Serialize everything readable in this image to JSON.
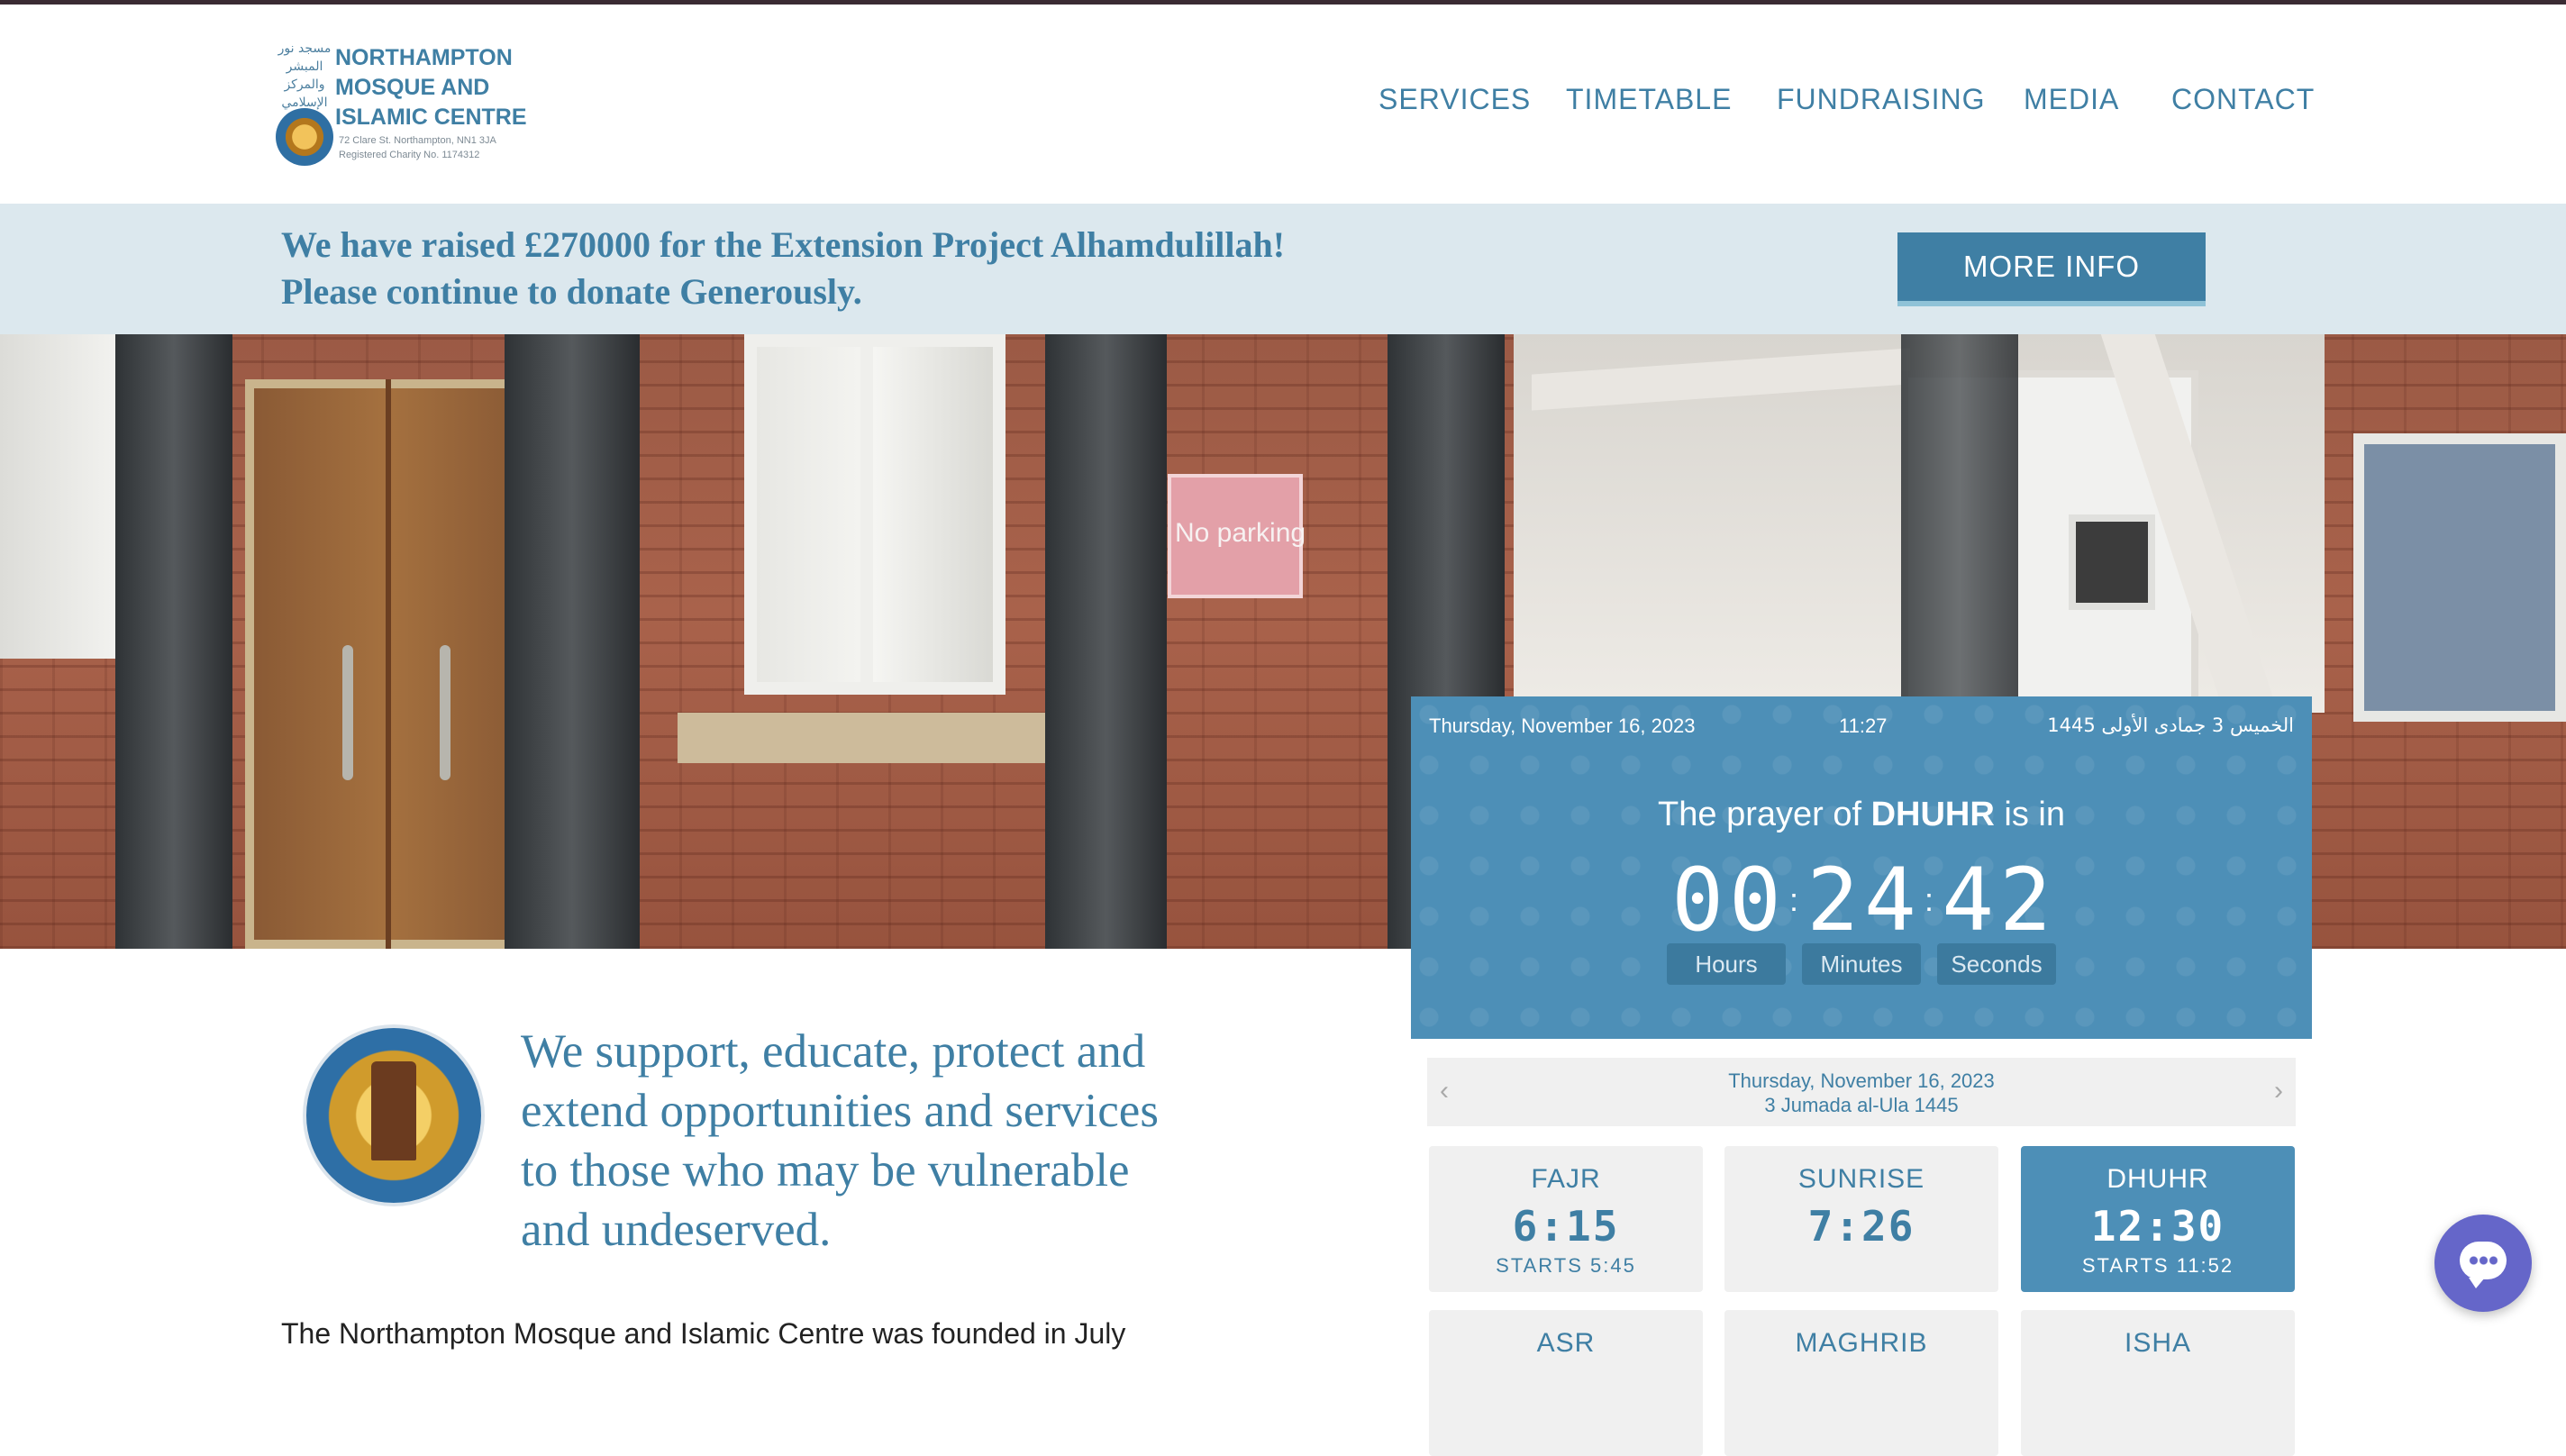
{
  "header": {
    "logo_title": "NORTHAMPTON MOSQUE AND ISLAMIC CENTRE",
    "logo_arabic": "مسجد نور المبشر والمركز الإسلامي",
    "logo_address": "72 Clare St. Northampton, NN1 3JA",
    "logo_charity": "Registered Charity No. 1174312",
    "nav": [
      "SERVICES",
      "TIMETABLE",
      "FUNDRAISING",
      "MEDIA",
      "CONTACT"
    ]
  },
  "banner": {
    "line1": "We have raised £270000 for the Extension Project Alhamdulillah!",
    "line2": "Please continue to donate Generously.",
    "button": "MORE INFO"
  },
  "hero": {
    "sign_text": "No parking"
  },
  "prayer_widget": {
    "date": "Thursday, November 16, 2023",
    "time": "11:27",
    "hijri_arabic": "الخميس 3 جمادى الأولى 1445",
    "prefix": "The prayer of",
    "prayer": "DHUHR",
    "suffix": "is in",
    "hours": "00",
    "minutes": "24",
    "seconds": "42",
    "hours_label": "Hours",
    "minutes_label": "Minutes",
    "seconds_label": "Seconds"
  },
  "timetable": {
    "date": "Thursday, November 16, 2023",
    "hijri": "3 Jumada al-Ula 1445",
    "prayers": [
      {
        "name": "FAJR",
        "time": "6:15",
        "starts": "STARTS 5:45"
      },
      {
        "name": "SUNRISE",
        "time": "7:26",
        "starts": ""
      },
      {
        "name": "DHUHR",
        "time": "12:30",
        "starts": "STARTS 11:52"
      },
      {
        "name": "ASR",
        "time": "",
        "starts": ""
      },
      {
        "name": "MAGHRIB",
        "time": "",
        "starts": ""
      },
      {
        "name": "ISHA",
        "time": "",
        "starts": ""
      }
    ]
  },
  "mission": "We support, educate, protect and extend opportunities and services to those who may be vulnerable and undeserved.",
  "intro": "The Northampton Mosque and Islamic Centre was founded in July",
  "colors": {
    "brand": "#3f7fa4",
    "widget": "#4d8fb7",
    "banner_bg": "#dce8ee",
    "chat": "#6566c9"
  }
}
